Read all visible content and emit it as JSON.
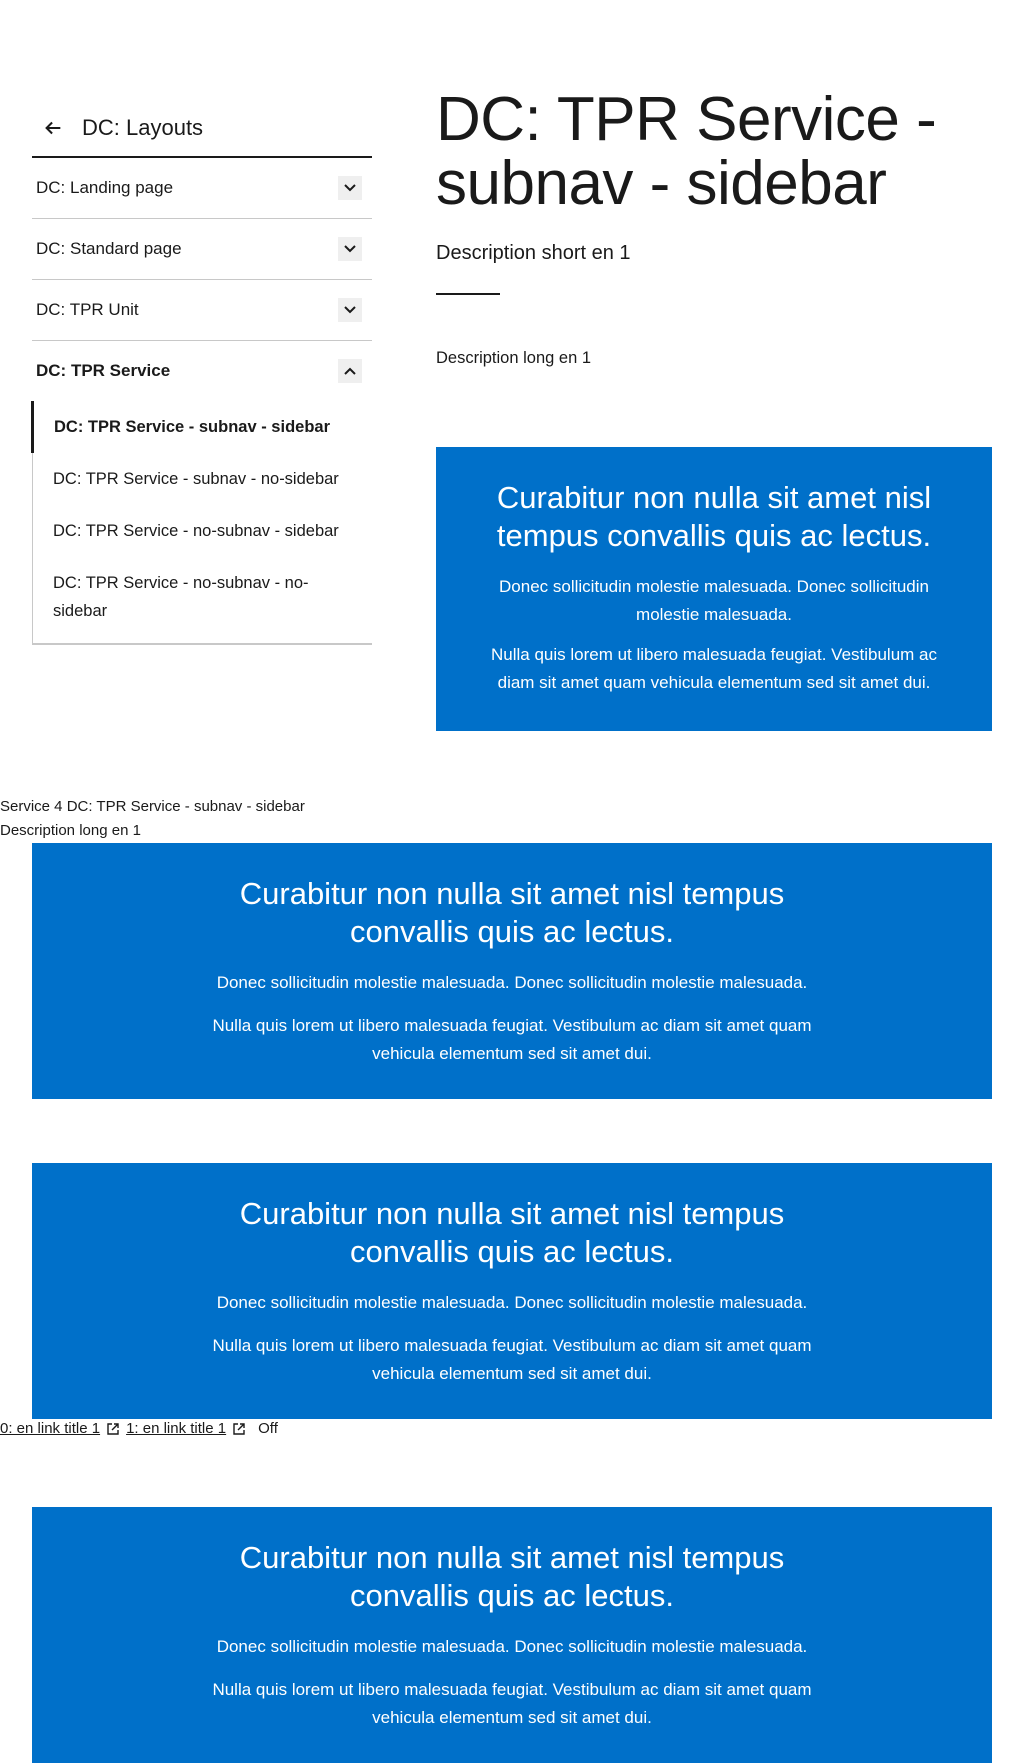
{
  "sidebar": {
    "back_label": "DC: Layouts",
    "items": [
      {
        "label": "DC: Landing page"
      },
      {
        "label": "DC: Standard page"
      },
      {
        "label": "DC: TPR Unit"
      },
      {
        "label": "DC: TPR Service"
      }
    ],
    "subitems": [
      {
        "label": "DC: TPR Service - subnav - sidebar"
      },
      {
        "label": "DC: TPR Service - subnav - no-sidebar"
      },
      {
        "label": "DC: TPR Service - no-subnav - sidebar"
      },
      {
        "label": "DC: TPR Service - no-subnav - no-sidebar"
      }
    ]
  },
  "main": {
    "title": "DC: TPR Service - subnav - sidebar",
    "short_description": "Description short en 1",
    "long_description": "Description long en 1"
  },
  "callout": {
    "heading": "Curabitur non nulla sit amet nisl tempus convallis quis ac lectus.",
    "para1": "Donec sollicitudin molestie malesuada. Donec sollicitudin molestie malesuada.",
    "para2": "Nulla quis lorem ut libero malesuada feugiat. Vestibulum ac diam sit amet quam vehicula elementum sed sit amet dui."
  },
  "loose": {
    "service_line": "Service 4 DC: TPR Service - subnav - sidebar",
    "desc_line": "Description long en 1"
  },
  "links": {
    "link0": "0: en link title 1",
    "link1": "1: en link title 1",
    "off": "Off"
  },
  "colors": {
    "accent_blue": "#0070c9",
    "text": "#1a1a1a"
  }
}
